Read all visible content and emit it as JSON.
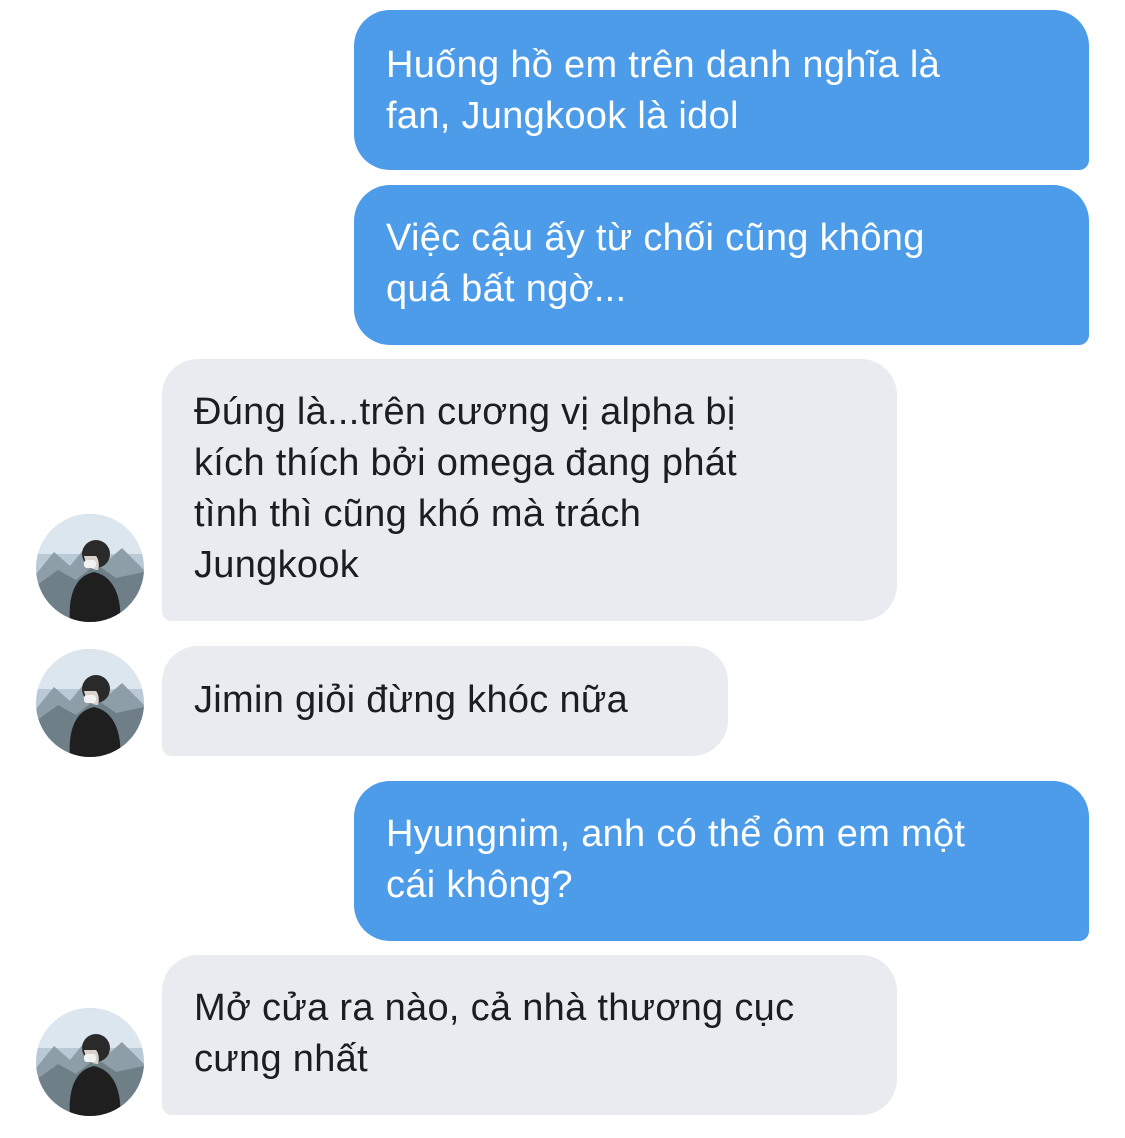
{
  "conversation": {
    "messages": [
      {
        "side": "sent",
        "lines": [
          "Huống hồ em trên danh nghĩa là",
          "fan, Jungkook là idol"
        ]
      },
      {
        "side": "sent",
        "lines": [
          "Việc cậu ấy từ chối cũng không",
          "quá bất ngờ..."
        ]
      },
      {
        "side": "received",
        "lines": [
          "Đúng là...trên cương vị alpha bị",
          "kích thích bởi omega đang phát",
          "tình thì cũng khó mà trách",
          "Jungkook"
        ],
        "avatar_icon": "profile-avatar"
      },
      {
        "side": "received",
        "lines": [
          "Jimin giỏi đừng khóc nữa"
        ],
        "avatar_icon": "profile-avatar"
      },
      {
        "side": "sent",
        "lines": [
          "Hyungnim, anh có thể ôm em một",
          "cái không?"
        ]
      },
      {
        "side": "received",
        "lines": [
          "Mở cửa ra nào, cả nhà thương cục",
          "cưng nhất"
        ],
        "avatar_icon": "profile-avatar"
      }
    ]
  },
  "colors": {
    "sent_bubble": "#4c9cea",
    "sent_text": "#ffffff",
    "received_bubble": "#e8ebef",
    "received_text": "#1a1d21",
    "background": "#ffffff"
  }
}
